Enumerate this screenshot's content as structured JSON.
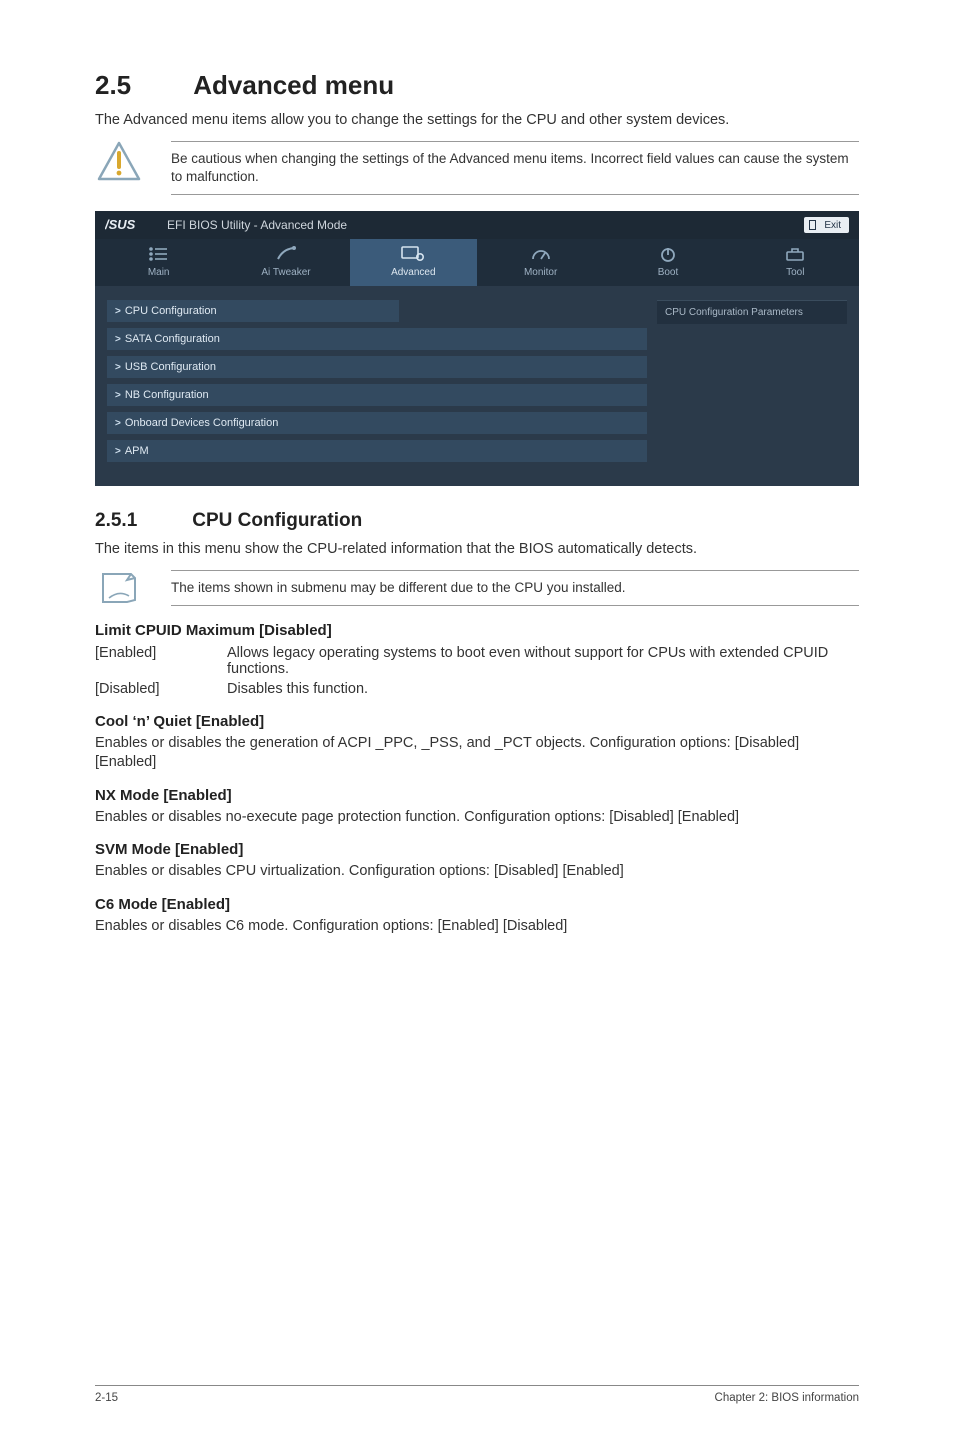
{
  "section": {
    "number": "2.5",
    "title": "Advanced menu"
  },
  "intro": "The Advanced menu items allow you to change the settings for the CPU and other system devices.",
  "warning": "Be cautious when changing the settings of the Advanced menu items. Incorrect field values can cause the system to malfunction.",
  "bios": {
    "brand_suffix": "EFI BIOS Utility - Advanced Mode",
    "exit_label": "Exit",
    "tabs": [
      {
        "label": "Main"
      },
      {
        "label": "Ai  Tweaker"
      },
      {
        "label": "Advanced"
      },
      {
        "label": "Monitor"
      },
      {
        "label": "Boot"
      },
      {
        "label": "Tool"
      }
    ],
    "right_box": "CPU Configuration Parameters",
    "items": [
      "CPU Configuration",
      "SATA Configuration",
      "USB Configuration",
      "NB Configuration",
      "Onboard Devices Configuration",
      "APM"
    ]
  },
  "sub": {
    "number": "2.5.1",
    "title": "CPU Configuration"
  },
  "sub_intro": "The items in this menu show the CPU-related information that the BIOS automatically detects.",
  "note": "The items shown in submenu may be different due to the CPU you installed.",
  "opts": {
    "limit_title": "Limit CPUID Maximum [Disabled]",
    "limit_rows": [
      {
        "key": "[Enabled]",
        "val": "Allows legacy operating systems to boot even without support for CPUs with extended CPUID functions."
      },
      {
        "key": "[Disabled]",
        "val": "Disables this function."
      }
    ],
    "cool_title": "Cool ‘n’ Quiet [Enabled]",
    "cool_body": "Enables or disables the generation of ACPI _PPC, _PSS, and _PCT objects. Configuration options: [Disabled] [Enabled]",
    "nx_title": "NX Mode [Enabled]",
    "nx_body": "Enables or disables no-execute page protection function. Configuration options: [Disabled] [Enabled]",
    "svm_title": "SVM Mode [Enabled]",
    "svm_body": "Enables or disables CPU virtualization. Configuration options: [Disabled] [Enabled]",
    "c6_title": "C6 Mode [Enabled]",
    "c6_body": "Enables or disables C6 mode. Configuration options: [Enabled] [Disabled]"
  },
  "footer": {
    "left": "2-15",
    "right": "Chapter 2: BIOS information"
  }
}
